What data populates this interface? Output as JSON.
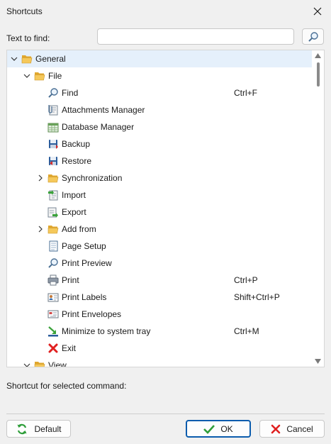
{
  "window": {
    "title": "Shortcuts"
  },
  "search": {
    "label": "Text to find:",
    "value": "",
    "placeholder": ""
  },
  "tree": {
    "general": {
      "label": "General"
    },
    "file": {
      "label": "File"
    },
    "items": [
      {
        "label": "Find",
        "shortcut": "Ctrl+F",
        "icon": "magnifier-icon"
      },
      {
        "label": "Attachments Manager",
        "shortcut": "",
        "icon": "paperclip-document-icon"
      },
      {
        "label": "Database Manager",
        "shortcut": "",
        "icon": "database-icon"
      },
      {
        "label": "Backup",
        "shortcut": "",
        "icon": "backup-icon"
      },
      {
        "label": "Restore",
        "shortcut": "",
        "icon": "restore-icon"
      },
      {
        "label": "Synchronization",
        "shortcut": "",
        "icon": "folder-icon"
      },
      {
        "label": "Import",
        "shortcut": "",
        "icon": "import-icon"
      },
      {
        "label": "Export",
        "shortcut": "",
        "icon": "export-icon"
      },
      {
        "label": "Add from",
        "shortcut": "",
        "icon": "folder-icon"
      },
      {
        "label": "Page Setup",
        "shortcut": "",
        "icon": "page-icon"
      },
      {
        "label": "Print Preview",
        "shortcut": "",
        "icon": "magnifier-icon"
      },
      {
        "label": "Print",
        "shortcut": "Ctrl+P",
        "icon": "printer-icon"
      },
      {
        "label": "Print Labels",
        "shortcut": "Shift+Ctrl+P",
        "icon": "contact-card-icon"
      },
      {
        "label": "Print Envelopes",
        "shortcut": "",
        "icon": "envelope-icon"
      },
      {
        "label": "Minimize to system tray",
        "shortcut": "Ctrl+M",
        "icon": "minimize-tray-icon"
      },
      {
        "label": "Exit",
        "shortcut": "",
        "icon": "red-x-icon"
      }
    ],
    "view": {
      "label": "View"
    }
  },
  "shortcut_section": {
    "label": "Shortcut for selected command:"
  },
  "buttons": {
    "default": "Default",
    "ok": "OK",
    "cancel": "Cancel"
  },
  "colors": {
    "selection": "#e5f0fb",
    "ok_border": "#0b5cad",
    "folder": "#f2c04a",
    "exit_red": "#e02020"
  }
}
